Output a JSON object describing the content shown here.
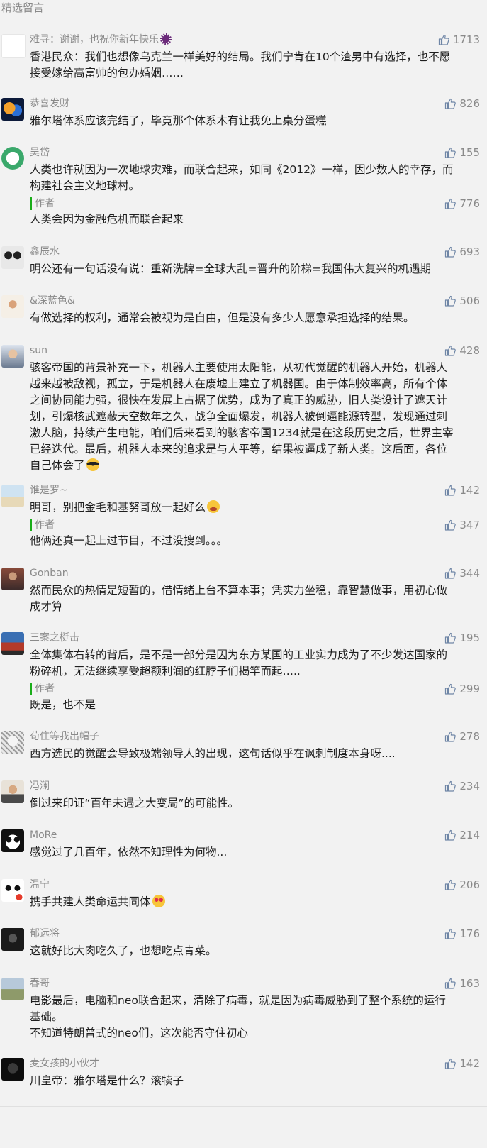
{
  "section_title": "精选留言",
  "reply_author_label": "作者",
  "colors": {
    "accent": "#1aad19",
    "meta_text": "#8a8a8a",
    "body_text": "#1e1e1e",
    "background": "#f2f2f2"
  },
  "comments": [
    {
      "nickname": "难寻：谢谢，也祝你新年快乐",
      "avatar_icon": "white-avatar",
      "likes": "1713",
      "lines": [
        "香港民众：我们也想像乌克兰一样美好的结局。我们宁肯在10个渣男中有选择，也不愿",
        "接受嫁给高富帅的包办婚姻……"
      ]
    },
    {
      "nickname": "恭喜发财",
      "avatar_icon": "fire-water-avatar",
      "likes": "826",
      "lines": [
        "雅尔塔体系应该完结了，毕竟那个体系木有让我免上桌分蛋糕"
      ]
    },
    {
      "nickname": "吴岱",
      "avatar_icon": "green-circle-avatar",
      "likes": "155",
      "lines": [
        "人类也许就因为一次地球灾难，而联合起来，如同《2012》一样，因少数人的幸存，而",
        "构建社会主义地球村。"
      ],
      "reply": {
        "likes": "776",
        "text": "人类会因为金融危机而联合起来"
      }
    },
    {
      "nickname": "鑫辰水",
      "avatar_icon": "panda-avatar",
      "likes": "693",
      "lines": [
        "明公还有一句话没有说：重新洗牌=全球大乱=晋升的阶梯=我国伟大复兴的机遇期"
      ]
    },
    {
      "nickname": "&深蓝色&",
      "avatar_icon": "tree-avatar",
      "likes": "506",
      "lines": [
        "有做选择的权利，通常会被视为是自由，但是没有多少人愿意承担选择的结果。"
      ]
    },
    {
      "nickname": "sun",
      "avatar_icon": "child-avatar",
      "likes": "428",
      "lines": [
        "骇客帝国的背景补充一下，机器人主要使用太阳能，从初代觉醒的机器人开始，机器人",
        "越来越被敌视，孤立，于是机器人在废墟上建立了机器国。由于体制效率高，所有个体",
        "之间协同能力强，很快在发展上占据了优势，成为了真正的威胁，旧人类设计了遮天计",
        "划，引爆核武遮蔽天空数年之久，战争全面爆发，机器人被倒逼能源转型，发现通过刺",
        "激人脑，持续产生电能，咱们后来看到的骇客帝国1234就是在这段历史之后，世界主宰",
        "已经迭代。最后，机器人本来的追求是与人平等，结果被逼成了新人类。这后面，各位",
        "自己体会了"
      ]
    },
    {
      "nickname": "谁是罗~",
      "avatar_icon": "beach-avatar",
      "likes": "142",
      "lines": [
        "明哥，别把金毛和基努哥放一起好么"
      ],
      "reply": {
        "likes": "347",
        "text": "他俩还真一起上过节目，不过没搜到。。。"
      }
    },
    {
      "nickname": "Gonban",
      "avatar_icon": "portrait-avatar",
      "likes": "344",
      "lines": [
        "然而民众的热情是短暂的，借情绪上台不算本事；凭实力坐稳，靠智慧做事，用初心做",
        "成才算"
      ]
    },
    {
      "nickname": "三案之梃击",
      "avatar_icon": "palace-avatar",
      "likes": "195",
      "lines": [
        "全体集体右转的背后，是不是一部分是因为东方某国的工业实力成为了不少发达国家的",
        "粉碎机，无法继续享受超额利润的红脖子们揭竿而起….."
      ],
      "reply": {
        "likes": "299",
        "text": "既是，也不是"
      }
    },
    {
      "nickname": "苟住等我出帽子",
      "avatar_icon": "sketch-avatar",
      "likes": "278",
      "lines": [
        "西方选民的觉醒会导致极端领导人的出现，这句话似乎在讽刺制度本身呀...."
      ]
    },
    {
      "nickname": "冯澜",
      "avatar_icon": "man-avatar",
      "likes": "234",
      "lines": [
        "倒过来印证“百年未遇之大变局”的可能性。"
      ]
    },
    {
      "nickname": "MoRe",
      "avatar_icon": "panda-face-avatar",
      "likes": "214",
      "lines": [
        "感觉过了几百年，依然不知理性为何物..."
      ]
    },
    {
      "nickname": "温宁",
      "avatar_icon": "panda-cartoon-avatar",
      "likes": "206",
      "lines": [
        "携手共建人类命运共同体"
      ]
    },
    {
      "nickname": "郁远将",
      "avatar_icon": "dark-avatar",
      "likes": "176",
      "lines": [
        "这就好比大肉吃久了，也想吃点青菜。"
      ]
    },
    {
      "nickname": "春哥",
      "avatar_icon": "landscape-avatar",
      "likes": "163",
      "lines": [
        "电影最后，电脑和neo联合起来，清除了病毒，就是因为病毒威胁到了整个系统的运行",
        "基础。",
        "不知道特朗普式的neo们，这次能否守住初心"
      ]
    },
    {
      "nickname": "麦女孩的小伙才",
      "avatar_icon": "black-avatar",
      "likes": "142",
      "lines": [
        "川皇帝：雅尔塔是什么？滚犊子"
      ]
    }
  ]
}
